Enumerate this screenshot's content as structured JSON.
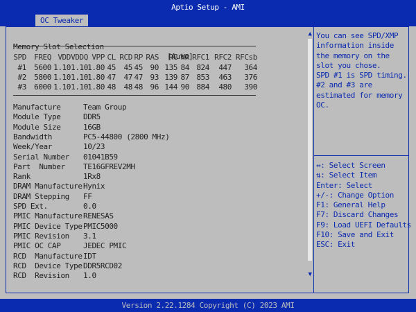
{
  "window": {
    "title": "Aptio Setup - AMI"
  },
  "tabs": [
    {
      "label": "OC Tweaker"
    }
  ],
  "memory_slot": {
    "label": "Memory Slot Selection",
    "value": "[Auto]"
  },
  "spd_table": {
    "headers": [
      "SPD",
      "FREQ",
      "VDD",
      "VDDQ",
      "VPP",
      "CL",
      "RCD",
      "RP",
      "RAS",
      "RC",
      "WR",
      "RFC1",
      "RFC2",
      "RFCsb"
    ],
    "rows": [
      [
        "#1",
        "5600",
        "1.10",
        "1.10",
        "1.80",
        "45",
        "45",
        "45",
        "90",
        "135",
        "84",
        "824",
        "447",
        "364"
      ],
      [
        "#2",
        "5800",
        "1.10",
        "1.10",
        "1.80",
        "47",
        "47",
        "47",
        "93",
        "139",
        "87",
        "853",
        "463",
        "376"
      ],
      [
        "#3",
        "6000",
        "1.10",
        "1.10",
        "1.80",
        "48",
        "48",
        "48",
        "96",
        "144",
        "90",
        "884",
        "480",
        "390"
      ]
    ]
  },
  "info": [
    {
      "label": "Manufacture",
      "value": "Team Group"
    },
    {
      "label": "Module Type",
      "value": "DDR5"
    },
    {
      "label": "Module Size",
      "value": "16GB"
    },
    {
      "label": "Bandwidth",
      "value": "PC5-44800 (2800 MHz)"
    },
    {
      "label": "Week/Year",
      "value": "10/23"
    },
    {
      "label": "Serial Number",
      "value": "01041B59"
    },
    {
      "label": "Part  Number",
      "value": "TE16GFREV2MH"
    },
    {
      "label": "Rank",
      "value": "1Rx8"
    },
    {
      "label": "DRAM Manufacture",
      "value": "Hynix"
    },
    {
      "label": "DRAM Stepping",
      "value": "FF"
    },
    {
      "label": "SPD Ext.",
      "value": "0.0"
    },
    {
      "label": "PMIC Manufacture",
      "value": "RENESAS"
    },
    {
      "label": "PMIC Device Type",
      "value": "PMIC5000"
    },
    {
      "label": "PMIC Revision",
      "value": "3.1"
    },
    {
      "label": "PMIC OC CAP",
      "value": "JEDEC PMIC"
    },
    {
      "label": "RCD  Manufacture",
      "value": "IDT"
    },
    {
      "label": "RCD  Device Type",
      "value": "DDR5RCD02"
    },
    {
      "label": "RCD  Revision",
      "value": "1.0"
    }
  ],
  "help": {
    "lines": [
      "You can see SPD/XMP",
      "information inside",
      "the memory on the",
      "slot you chose.",
      "SPD #1 is SPD timing.",
      "#2 and #3 are",
      "estimated for memory",
      "OC."
    ]
  },
  "keys": [
    "↔: Select Screen",
    "⇅: Select Item",
    "Enter: Select",
    "+/-: Change Option",
    "F1: General Help",
    "F7: Discard Changes",
    "F9: Load UEFI Defaults",
    "F10: Save and Exit",
    "ESC: Exit"
  ],
  "footer": {
    "text": "Version 2.22.1284 Copyright (C) 2023 AMI"
  },
  "colors": {
    "accent": "#0a2bb0",
    "background": "#bdbdbd",
    "text": "#202020"
  },
  "icons": {
    "scroll_up": "scroll-up-arrow-icon",
    "scroll_down": "scroll-down-arrow-icon"
  }
}
